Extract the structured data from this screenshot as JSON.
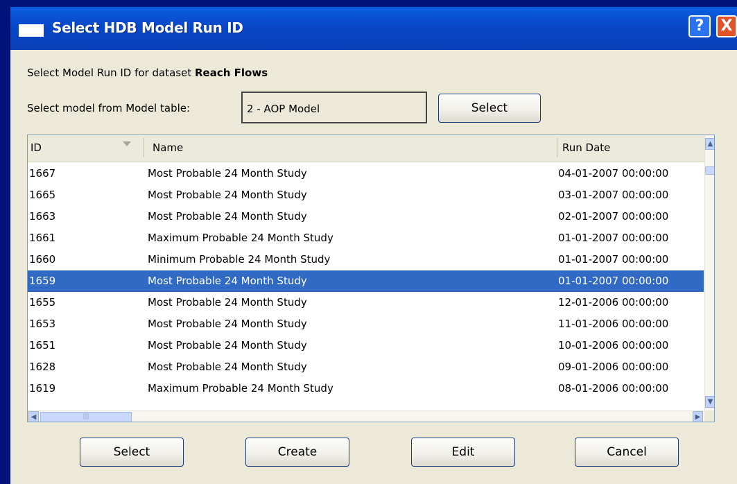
{
  "window": {
    "title": "Select HDB Model Run ID",
    "help_label": "?",
    "close_label": "X"
  },
  "dataset": {
    "prefix": "Select Model Run ID for dataset ",
    "name": "Reach Flows"
  },
  "model": {
    "label": "Select model from Model table:",
    "value": "2 - AOP Model",
    "select_label": "Select"
  },
  "table": {
    "columns": [
      "ID",
      "Name",
      "Run Date"
    ],
    "selected_id": "1659",
    "rows": [
      {
        "id": "1667",
        "name": "Most Probable 24 Month Study",
        "run_date": "04-01-2007 00:00:00"
      },
      {
        "id": "1665",
        "name": "Most Probable 24 Month Study",
        "run_date": "03-01-2007 00:00:00"
      },
      {
        "id": "1663",
        "name": "Most Probable 24 Month Study",
        "run_date": "02-01-2007 00:00:00"
      },
      {
        "id": "1661",
        "name": "Maximum Probable 24 Month Study",
        "run_date": "01-01-2007 00:00:00"
      },
      {
        "id": "1660",
        "name": "Minimum Probable 24 Month Study",
        "run_date": "01-01-2007 00:00:00"
      },
      {
        "id": "1659",
        "name": "Most Probable 24 Month Study",
        "run_date": "01-01-2007 00:00:00"
      },
      {
        "id": "1655",
        "name": "Most Probable 24 Month Study",
        "run_date": "12-01-2006 00:00:00"
      },
      {
        "id": "1653",
        "name": "Most Probable 24 Month Study",
        "run_date": "11-01-2006 00:00:00"
      },
      {
        "id": "1651",
        "name": "Most Probable 24 Month Study",
        "run_date": "10-01-2006 00:00:00"
      },
      {
        "id": "1628",
        "name": "Most Probable 24 Month Study",
        "run_date": "09-01-2006 00:00:00"
      },
      {
        "id": "1619",
        "name": "Maximum Probable 24 Month Study",
        "run_date": "08-01-2006 00:00:00"
      }
    ]
  },
  "buttons": {
    "select": "Select",
    "create": "Create",
    "edit": "Edit",
    "cancel": "Cancel"
  },
  "icons": {
    "sort": "sort-down-icon",
    "scroll_up": "scroll-up-icon",
    "scroll_down": "scroll-down-icon",
    "scroll_left": "scroll-left-icon",
    "scroll_right": "scroll-right-icon"
  },
  "colors": {
    "desktop": "#03127a",
    "titlebar": "#0847c8",
    "selection": "#316ac5",
    "dialog": "#ece9d8"
  }
}
